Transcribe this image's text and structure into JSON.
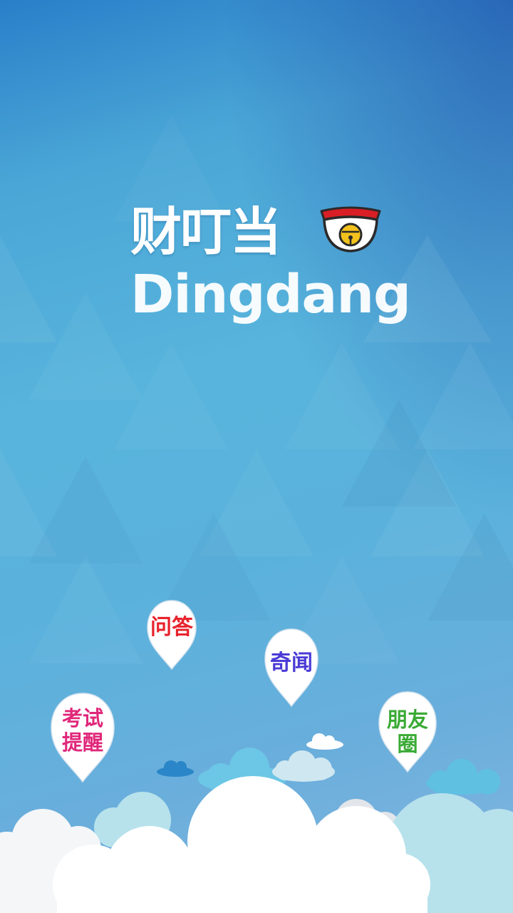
{
  "app": {
    "name_cn": "财叮当",
    "name_en": "Dingdang"
  },
  "logo_icon": "bell-collar-icon",
  "pins": {
    "qa": {
      "label": "问答",
      "color": "#e8232d"
    },
    "news": {
      "label": "奇闻",
      "color": "#4a3bd6"
    },
    "exam": {
      "line1": "考试",
      "line2": "提醒",
      "color": "#e0277a"
    },
    "friends": {
      "line1": "朋友",
      "line2": "圈",
      "color": "#3aaa35"
    }
  },
  "colors": {
    "background_top": "#2a7fc9",
    "background_mid": "#58b4dc",
    "bell_band": "#d91e25",
    "bell_gold": "#f3c21d"
  }
}
